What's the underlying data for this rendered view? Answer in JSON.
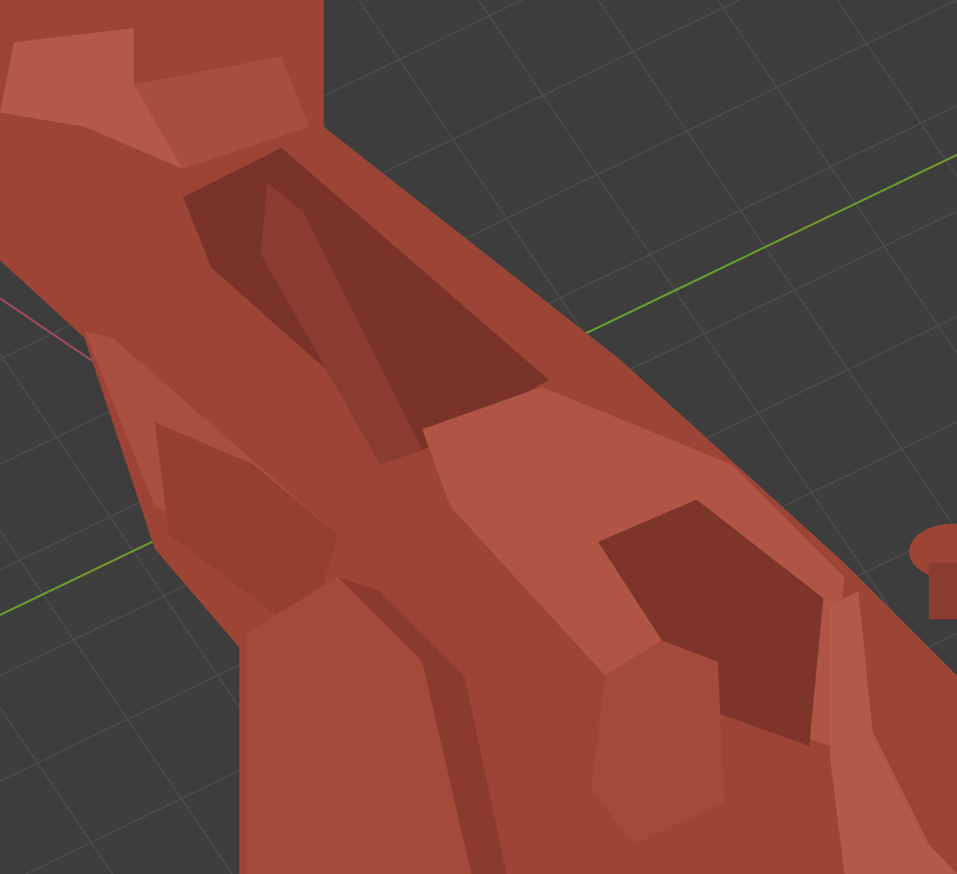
{
  "viewport": {
    "kind": "perspective",
    "axes": [
      {
        "kind": "x",
        "color": "#a04a5c"
      },
      {
        "kind": "y",
        "color": "#6c9a2e"
      }
    ]
  }
}
